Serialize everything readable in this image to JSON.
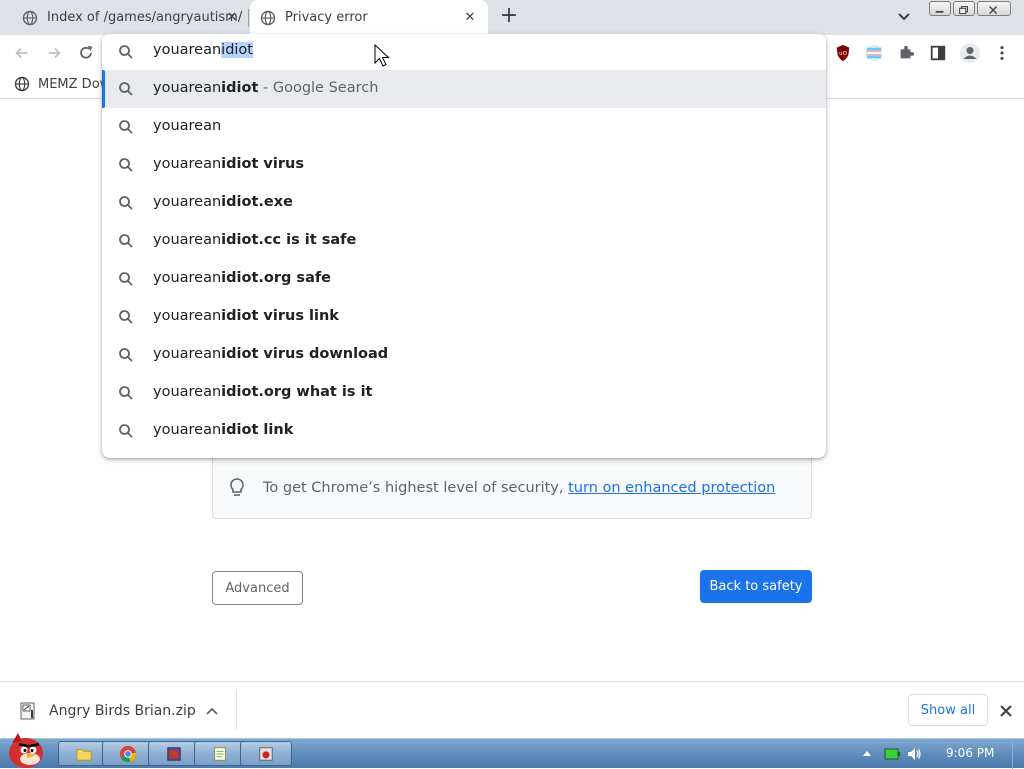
{
  "tabs": [
    {
      "title": "Index of /games/angryautism/",
      "active": false
    },
    {
      "title": "Privacy error",
      "active": true
    }
  ],
  "new_tab_label": "+",
  "bookmarks": [
    {
      "label": "MEMZ Dow"
    }
  ],
  "omnibox": {
    "typed": "youarean",
    "autocompleted": "idiot",
    "suggestions": [
      {
        "prefix": "youarean",
        "bold": "idiot",
        "suffix": " - Google Search",
        "selected": true
      },
      {
        "prefix": "youarean",
        "bold": "",
        "suffix": "",
        "selected": false
      },
      {
        "prefix": "youarean",
        "bold": "idiot virus",
        "suffix": "",
        "selected": false
      },
      {
        "prefix": "youarean",
        "bold": "idiot.exe",
        "suffix": "",
        "selected": false
      },
      {
        "prefix": "youarean",
        "bold": "idiot.cc is it safe",
        "suffix": "",
        "selected": false
      },
      {
        "prefix": "youarean",
        "bold": "idiot.org safe",
        "suffix": "",
        "selected": false
      },
      {
        "prefix": "youarean",
        "bold": "idiot virus link",
        "suffix": "",
        "selected": false
      },
      {
        "prefix": "youarean",
        "bold": "idiot virus download",
        "suffix": "",
        "selected": false
      },
      {
        "prefix": "youarean",
        "bold": "idiot.org what is it",
        "suffix": "",
        "selected": false
      },
      {
        "prefix": "youarean",
        "bold": "idiot link",
        "suffix": "",
        "selected": false
      }
    ]
  },
  "page": {
    "tip_text": "To get Chrome’s highest level of security, ",
    "tip_link": "turn on enhanced protection",
    "advanced_label": "Advanced",
    "back_to_safety_label": "Back to safety"
  },
  "download": {
    "filename": "Angry Birds Brian.zip",
    "show_all_label": "Show all"
  },
  "taskbar": {
    "clock": "9:06 PM"
  },
  "colors": {
    "accent": "#1a73e8",
    "tabstrip": "#dee1e6",
    "taskbar": "#5d8bba"
  }
}
